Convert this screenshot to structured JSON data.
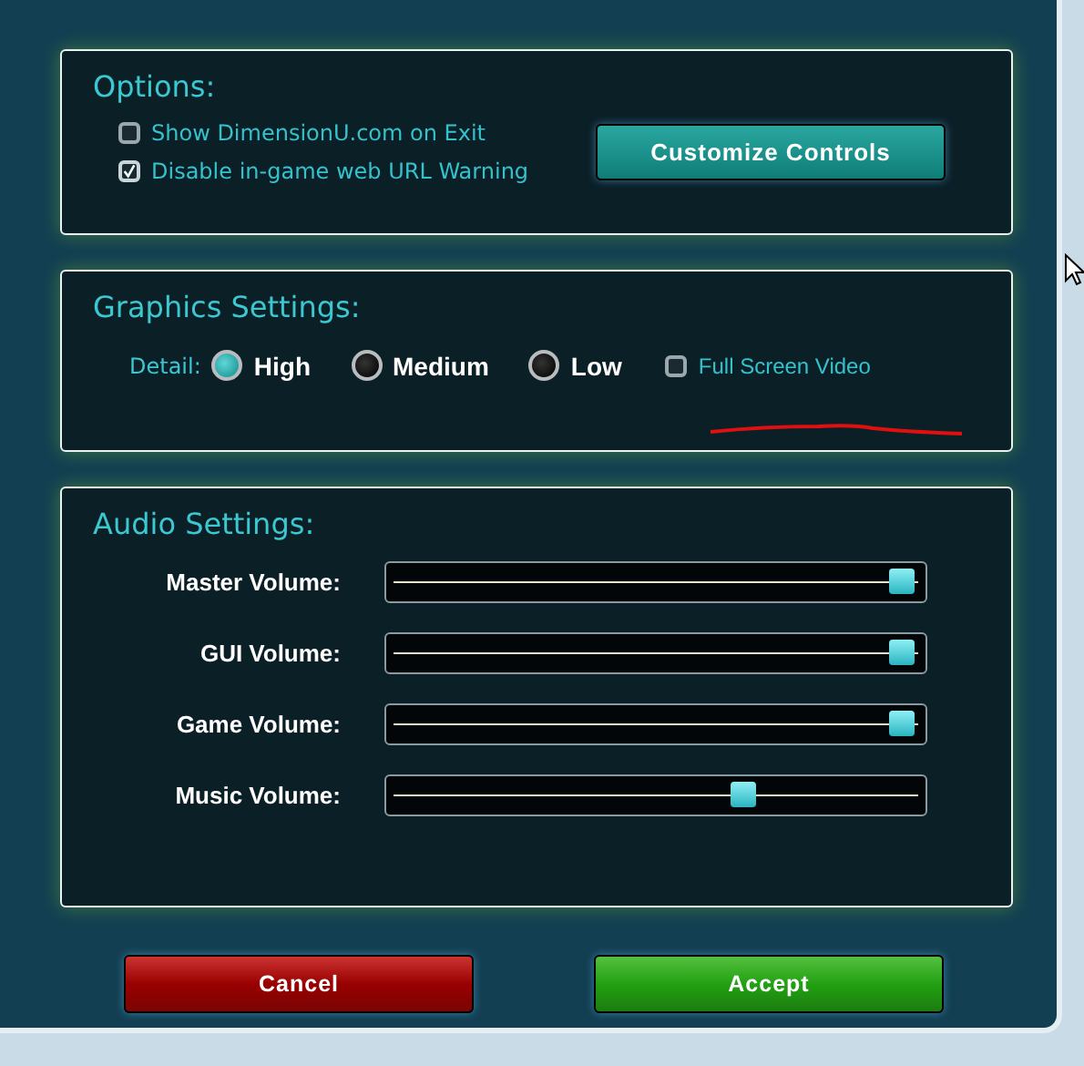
{
  "options": {
    "title": "Options:",
    "checkboxes": [
      {
        "label": "Show DimensionU.com on Exit",
        "checked": false
      },
      {
        "label": "Disable in-game web URL Warning",
        "checked": true
      }
    ],
    "button": "Customize Controls"
  },
  "graphics": {
    "title": "Graphics Settings:",
    "detail_label": "Detail:",
    "detail_options": [
      {
        "label": "High",
        "selected": true
      },
      {
        "label": "Medium",
        "selected": false
      },
      {
        "label": "Low",
        "selected": false
      }
    ],
    "full_screen_video": {
      "label": "Full Screen Video",
      "checked": false
    }
  },
  "audio": {
    "title": "Audio Settings:",
    "sliders": [
      {
        "label": "Master Volume:",
        "level": 1
      },
      {
        "label": "GUI Volume:",
        "level": 1
      },
      {
        "label": "Game Volume:",
        "level": 1
      },
      {
        "label": "Music Volume:",
        "level": 0.68
      }
    ]
  },
  "buttons": [
    {
      "label": "Cancel",
      "kind": "cancel"
    },
    {
      "label": "Accept",
      "kind": "accept"
    }
  ]
}
